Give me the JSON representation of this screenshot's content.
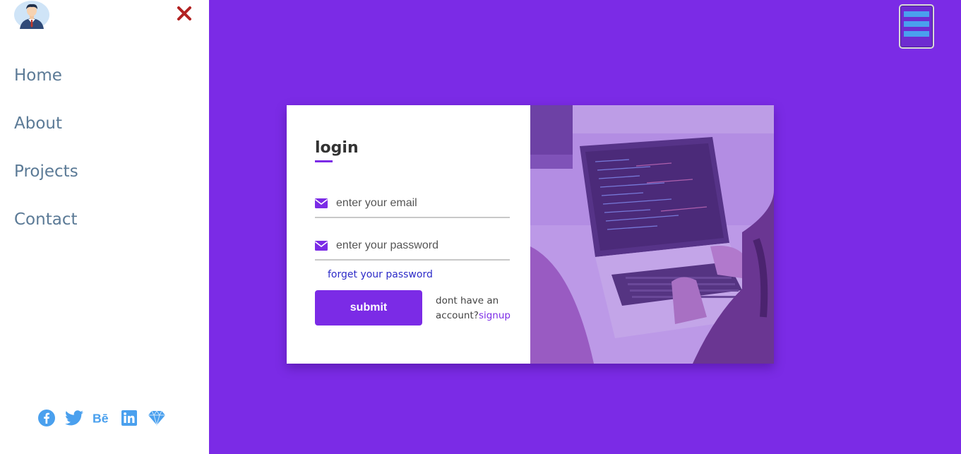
{
  "sidebar": {
    "nav": [
      {
        "label": "Home"
      },
      {
        "label": "About"
      },
      {
        "label": "Projects"
      },
      {
        "label": "Contact"
      }
    ],
    "socials": [
      "facebook-icon",
      "twitter-icon",
      "behance-icon",
      "linkedin-icon",
      "diamond-icon"
    ],
    "close_icon": "close-icon"
  },
  "login": {
    "title": "login",
    "email_placeholder": "enter your email",
    "password_placeholder": "enter your password",
    "forgot_label": "forget your password",
    "submit_label": "submit",
    "signup_prompt": "dont have an account?",
    "signup_label": "signup"
  },
  "colors": {
    "background": "#7b2be6",
    "accent": "#7b2be6",
    "nav_text": "#5b7a96",
    "social_icons": "#4aa0ee",
    "close_icon": "#b22222"
  }
}
